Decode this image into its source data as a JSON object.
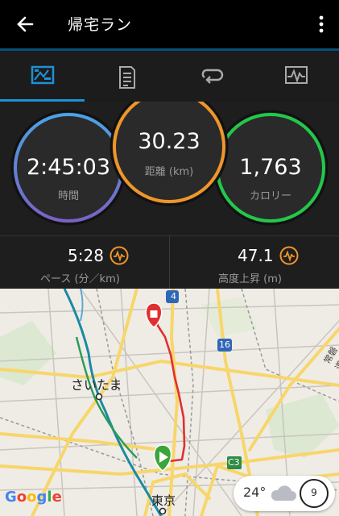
{
  "appbar": {
    "title": "帰宅ラン"
  },
  "tabs": [
    {
      "icon": "summary-chart-icon",
      "active": true
    },
    {
      "icon": "document-icon",
      "active": false
    },
    {
      "icon": "laps-icon",
      "active": false
    },
    {
      "icon": "graph-icon",
      "active": false
    }
  ],
  "rings": {
    "time": {
      "value": "2:45:03",
      "label": "時間"
    },
    "distance": {
      "value": "30.23",
      "label": "距離 (km)"
    },
    "calories": {
      "value": "1,763",
      "label": "カロリー"
    }
  },
  "stats": {
    "pace": {
      "value": "5:28",
      "label": "ペース (分／km)"
    },
    "elevation": {
      "value": "47.1",
      "label": "高度上昇 (m)"
    }
  },
  "map": {
    "labels": {
      "saitama": "さいたま",
      "tokyo": "東京",
      "joban": "常磐道",
      "route4": "4",
      "route16": "16",
      "c3": "C3"
    },
    "google": "Google",
    "weather": {
      "temp": "24°",
      "wind": "9"
    }
  },
  "colors": {
    "accent": "#1e90d6",
    "ring_time": "#4a9fe0",
    "ring_distance": "#f0962a",
    "ring_calories": "#22c84a",
    "route": "#e03030"
  }
}
